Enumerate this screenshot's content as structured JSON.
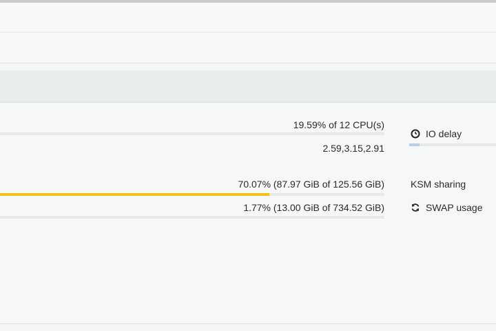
{
  "colors": {
    "memory_bar": "#f2c21b",
    "io_delay_bar": "#b8cfe6",
    "track": "#e6e9e8"
  },
  "status": {
    "cpu_usage": {
      "text": "19.59% of 12 CPU(s)",
      "percent": 19.59
    },
    "load_average": {
      "text": "2.59,3.15,2.91"
    },
    "ram_usage": {
      "text": "70.07% (87.97 GiB of 125.56 GiB)",
      "percent": 70.07
    },
    "hd_space": {
      "text": "1.77% (13.00 GiB of 734.52 GiB)",
      "percent": 1.77
    }
  },
  "side": {
    "io_delay": {
      "label": "IO delay",
      "icon": "clock-icon",
      "percent": 12
    },
    "ksm_sharing": {
      "label": "KSM sharing"
    },
    "swap_usage": {
      "label": "SWAP usage",
      "icon": "refresh-icon"
    }
  }
}
